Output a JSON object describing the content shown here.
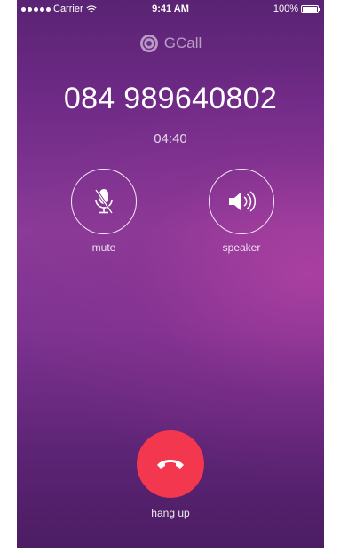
{
  "status_bar": {
    "carrier": "Carrier",
    "time": "9:41 AM",
    "battery": "100%"
  },
  "brand": {
    "name": "GCall"
  },
  "call": {
    "number": "084 989640802",
    "duration": "04:40"
  },
  "controls": {
    "mute_label": "mute",
    "speaker_label": "speaker",
    "hangup_label": "hang up"
  },
  "colors": {
    "hangup": "#f2374e",
    "background_top": "#5a2373",
    "background_mid": "#8a3a97"
  },
  "icons": {
    "mute": "mic-off-icon",
    "speaker": "speaker-icon",
    "hangup": "phone-hangup-icon",
    "brand": "gcall-logo-icon"
  }
}
